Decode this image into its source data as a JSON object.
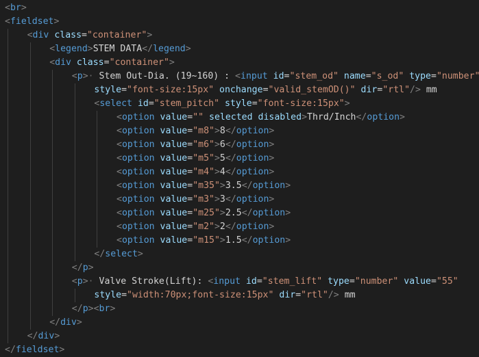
{
  "editor": {
    "language": "html",
    "theme": {
      "background": "#1e1e1e",
      "punctuation": "#808080",
      "tag": "#569cd6",
      "attribute": "#9cdcfe",
      "string": "#ce9178",
      "text": "#d4d4d4",
      "whitespace_marker": "#6a6a6a",
      "indent_guide": "#404040"
    },
    "lines": [
      {
        "indent": 0,
        "tokens": [
          [
            "p",
            "<"
          ],
          [
            "t",
            "br"
          ],
          [
            "p",
            ">"
          ]
        ]
      },
      {
        "indent": 0,
        "tokens": [
          [
            "p",
            "<"
          ],
          [
            "t",
            "fieldset"
          ],
          [
            "p",
            ">"
          ]
        ]
      },
      {
        "indent": 1,
        "tokens": [
          [
            "p",
            "<"
          ],
          [
            "t",
            "div"
          ],
          [
            "x",
            " "
          ],
          [
            "a",
            "class"
          ],
          [
            "x",
            "="
          ],
          [
            "s",
            "\"container\""
          ],
          [
            "p",
            ">"
          ]
        ]
      },
      {
        "indent": 2,
        "tokens": [
          [
            "p",
            "<"
          ],
          [
            "t",
            "legend"
          ],
          [
            "p",
            ">"
          ],
          [
            "x",
            "STEM DATA"
          ],
          [
            "p",
            "</"
          ],
          [
            "t",
            "legend"
          ],
          [
            "p",
            ">"
          ]
        ]
      },
      {
        "indent": 2,
        "tokens": [
          [
            "p",
            "<"
          ],
          [
            "t",
            "div"
          ],
          [
            "x",
            " "
          ],
          [
            "a",
            "class"
          ],
          [
            "x",
            "="
          ],
          [
            "s",
            "\"container\""
          ],
          [
            "p",
            ">"
          ]
        ]
      },
      {
        "indent": 3,
        "tokens": [
          [
            "p",
            "<"
          ],
          [
            "t",
            "p"
          ],
          [
            "p",
            ">"
          ],
          [
            "w",
            "·"
          ],
          [
            "x",
            " Stem Out-Dia. (19~160) : "
          ],
          [
            "p",
            "<"
          ],
          [
            "t",
            "input"
          ],
          [
            "x",
            " "
          ],
          [
            "a",
            "id"
          ],
          [
            "x",
            "="
          ],
          [
            "s",
            "\"stem_od\""
          ],
          [
            "x",
            " "
          ],
          [
            "a",
            "name"
          ],
          [
            "x",
            "="
          ],
          [
            "s",
            "\"s_od\""
          ],
          [
            "x",
            " "
          ],
          [
            "a",
            "type"
          ],
          [
            "x",
            "="
          ],
          [
            "s",
            "\"number\""
          ]
        ]
      },
      {
        "indent": 4,
        "tokens": [
          [
            "a",
            "style"
          ],
          [
            "x",
            "="
          ],
          [
            "s",
            "\"font-size:15px\""
          ],
          [
            "x",
            " "
          ],
          [
            "a",
            "onchange"
          ],
          [
            "x",
            "="
          ],
          [
            "s",
            "\"valid_stemOD()\""
          ],
          [
            "x",
            " "
          ],
          [
            "a",
            "dir"
          ],
          [
            "x",
            "="
          ],
          [
            "s",
            "\"rtl\""
          ],
          [
            "p",
            "/>"
          ],
          [
            "x",
            " mm"
          ]
        ]
      },
      {
        "indent": 4,
        "tokens": [
          [
            "p",
            "<"
          ],
          [
            "t",
            "select"
          ],
          [
            "x",
            " "
          ],
          [
            "a",
            "id"
          ],
          [
            "x",
            "="
          ],
          [
            "s",
            "\"stem_pitch\""
          ],
          [
            "x",
            " "
          ],
          [
            "a",
            "style"
          ],
          [
            "x",
            "="
          ],
          [
            "s",
            "\"font-size:15px\""
          ],
          [
            "p",
            ">"
          ]
        ]
      },
      {
        "indent": 5,
        "tokens": [
          [
            "p",
            "<"
          ],
          [
            "t",
            "option"
          ],
          [
            "x",
            " "
          ],
          [
            "a",
            "value"
          ],
          [
            "x",
            "="
          ],
          [
            "s",
            "\"\""
          ],
          [
            "x",
            " "
          ],
          [
            "a",
            "selected"
          ],
          [
            "x",
            " "
          ],
          [
            "a",
            "disabled"
          ],
          [
            "p",
            ">"
          ],
          [
            "x",
            "Thrd/Inch"
          ],
          [
            "p",
            "</"
          ],
          [
            "t",
            "option"
          ],
          [
            "p",
            ">"
          ]
        ]
      },
      {
        "indent": 5,
        "tokens": [
          [
            "p",
            "<"
          ],
          [
            "t",
            "option"
          ],
          [
            "x",
            " "
          ],
          [
            "a",
            "value"
          ],
          [
            "x",
            "="
          ],
          [
            "s",
            "\"m8\""
          ],
          [
            "p",
            ">"
          ],
          [
            "x",
            "8"
          ],
          [
            "p",
            "</"
          ],
          [
            "t",
            "option"
          ],
          [
            "p",
            ">"
          ]
        ]
      },
      {
        "indent": 5,
        "tokens": [
          [
            "p",
            "<"
          ],
          [
            "t",
            "option"
          ],
          [
            "x",
            " "
          ],
          [
            "a",
            "value"
          ],
          [
            "x",
            "="
          ],
          [
            "s",
            "\"m6\""
          ],
          [
            "p",
            ">"
          ],
          [
            "x",
            "6"
          ],
          [
            "p",
            "</"
          ],
          [
            "t",
            "option"
          ],
          [
            "p",
            ">"
          ]
        ]
      },
      {
        "indent": 5,
        "tokens": [
          [
            "p",
            "<"
          ],
          [
            "t",
            "option"
          ],
          [
            "x",
            " "
          ],
          [
            "a",
            "value"
          ],
          [
            "x",
            "="
          ],
          [
            "s",
            "\"m5\""
          ],
          [
            "p",
            ">"
          ],
          [
            "x",
            "5"
          ],
          [
            "p",
            "</"
          ],
          [
            "t",
            "option"
          ],
          [
            "p",
            ">"
          ]
        ]
      },
      {
        "indent": 5,
        "tokens": [
          [
            "p",
            "<"
          ],
          [
            "t",
            "option"
          ],
          [
            "x",
            " "
          ],
          [
            "a",
            "value"
          ],
          [
            "x",
            "="
          ],
          [
            "s",
            "\"m4\""
          ],
          [
            "p",
            ">"
          ],
          [
            "x",
            "4"
          ],
          [
            "p",
            "</"
          ],
          [
            "t",
            "option"
          ],
          [
            "p",
            ">"
          ]
        ]
      },
      {
        "indent": 5,
        "tokens": [
          [
            "p",
            "<"
          ],
          [
            "t",
            "option"
          ],
          [
            "x",
            " "
          ],
          [
            "a",
            "value"
          ],
          [
            "x",
            "="
          ],
          [
            "s",
            "\"m35\""
          ],
          [
            "p",
            ">"
          ],
          [
            "x",
            "3.5"
          ],
          [
            "p",
            "</"
          ],
          [
            "t",
            "option"
          ],
          [
            "p",
            ">"
          ]
        ]
      },
      {
        "indent": 5,
        "tokens": [
          [
            "p",
            "<"
          ],
          [
            "t",
            "option"
          ],
          [
            "x",
            " "
          ],
          [
            "a",
            "value"
          ],
          [
            "x",
            "="
          ],
          [
            "s",
            "\"m3\""
          ],
          [
            "p",
            ">"
          ],
          [
            "x",
            "3"
          ],
          [
            "p",
            "</"
          ],
          [
            "t",
            "option"
          ],
          [
            "p",
            ">"
          ]
        ]
      },
      {
        "indent": 5,
        "tokens": [
          [
            "p",
            "<"
          ],
          [
            "t",
            "option"
          ],
          [
            "x",
            " "
          ],
          [
            "a",
            "value"
          ],
          [
            "x",
            "="
          ],
          [
            "s",
            "\"m25\""
          ],
          [
            "p",
            ">"
          ],
          [
            "x",
            "2.5"
          ],
          [
            "p",
            "</"
          ],
          [
            "t",
            "option"
          ],
          [
            "p",
            ">"
          ]
        ]
      },
      {
        "indent": 5,
        "tokens": [
          [
            "p",
            "<"
          ],
          [
            "t",
            "option"
          ],
          [
            "x",
            " "
          ],
          [
            "a",
            "value"
          ],
          [
            "x",
            "="
          ],
          [
            "s",
            "\"m2\""
          ],
          [
            "p",
            ">"
          ],
          [
            "x",
            "2"
          ],
          [
            "p",
            "</"
          ],
          [
            "t",
            "option"
          ],
          [
            "p",
            ">"
          ]
        ]
      },
      {
        "indent": 5,
        "tokens": [
          [
            "p",
            "<"
          ],
          [
            "t",
            "option"
          ],
          [
            "x",
            " "
          ],
          [
            "a",
            "value"
          ],
          [
            "x",
            "="
          ],
          [
            "s",
            "\"m15\""
          ],
          [
            "p",
            ">"
          ],
          [
            "x",
            "1.5"
          ],
          [
            "p",
            "</"
          ],
          [
            "t",
            "option"
          ],
          [
            "p",
            ">"
          ]
        ]
      },
      {
        "indent": 4,
        "tokens": [
          [
            "p",
            "</"
          ],
          [
            "t",
            "select"
          ],
          [
            "p",
            ">"
          ]
        ]
      },
      {
        "indent": 3,
        "tokens": [
          [
            "p",
            "</"
          ],
          [
            "t",
            "p"
          ],
          [
            "p",
            ">"
          ]
        ]
      },
      {
        "indent": 3,
        "tokens": [
          [
            "p",
            "<"
          ],
          [
            "t",
            "p"
          ],
          [
            "p",
            ">"
          ],
          [
            "w",
            "·"
          ],
          [
            "x",
            " Valve Stroke(Lift): "
          ],
          [
            "p",
            "<"
          ],
          [
            "t",
            "input"
          ],
          [
            "x",
            " "
          ],
          [
            "a",
            "id"
          ],
          [
            "x",
            "="
          ],
          [
            "s",
            "\"stem_lift\""
          ],
          [
            "x",
            " "
          ],
          [
            "a",
            "type"
          ],
          [
            "x",
            "="
          ],
          [
            "s",
            "\"number\""
          ],
          [
            "x",
            " "
          ],
          [
            "a",
            "value"
          ],
          [
            "x",
            "="
          ],
          [
            "s",
            "\"55\""
          ]
        ]
      },
      {
        "indent": 4,
        "tokens": [
          [
            "a",
            "style"
          ],
          [
            "x",
            "="
          ],
          [
            "s",
            "\"width:70px;font-size:15px\""
          ],
          [
            "x",
            " "
          ],
          [
            "a",
            "dir"
          ],
          [
            "x",
            "="
          ],
          [
            "s",
            "\"rtl\""
          ],
          [
            "p",
            "/>"
          ],
          [
            "x",
            " mm"
          ]
        ]
      },
      {
        "indent": 3,
        "tokens": [
          [
            "p",
            "</"
          ],
          [
            "t",
            "p"
          ],
          [
            "p",
            ">"
          ],
          [
            "p",
            "<"
          ],
          [
            "t",
            "br"
          ],
          [
            "p",
            ">"
          ]
        ]
      },
      {
        "indent": 2,
        "tokens": [
          [
            "p",
            "</"
          ],
          [
            "t",
            "div"
          ],
          [
            "p",
            ">"
          ]
        ]
      },
      {
        "indent": 1,
        "tokens": [
          [
            "p",
            "</"
          ],
          [
            "t",
            "div"
          ],
          [
            "p",
            ">"
          ]
        ]
      },
      {
        "indent": 0,
        "tokens": [
          [
            "p",
            "</"
          ],
          [
            "t",
            "fieldset"
          ],
          [
            "p",
            ">"
          ]
        ]
      }
    ]
  }
}
